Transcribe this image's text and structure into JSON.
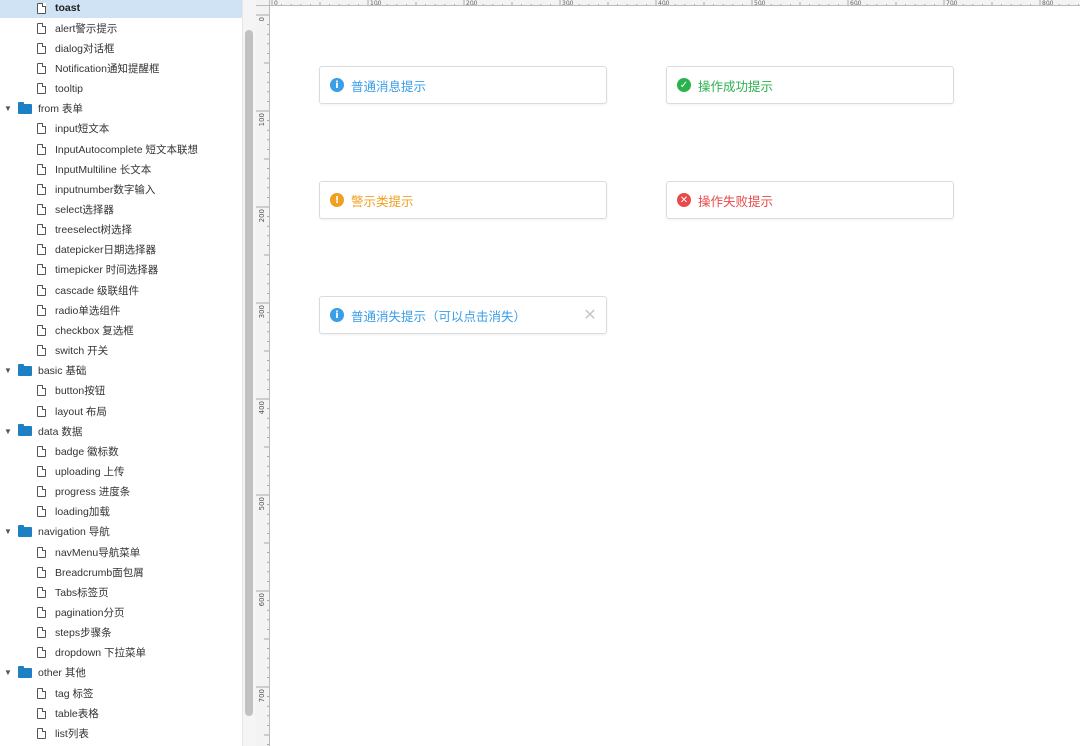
{
  "sidebar": {
    "items": [
      {
        "type": "page",
        "label": "toast",
        "selected": true
      },
      {
        "type": "page",
        "label": "alert警示提示"
      },
      {
        "type": "page",
        "label": "dialog对话框"
      },
      {
        "type": "page",
        "label": "Notification通知提醒框"
      },
      {
        "type": "page",
        "label": "tooltip"
      },
      {
        "type": "folder",
        "label": "from 表单"
      },
      {
        "type": "page",
        "label": "input短文本"
      },
      {
        "type": "page",
        "label": "InputAutocomplete 短文本联想"
      },
      {
        "type": "page",
        "label": "InputMultiline 长文本"
      },
      {
        "type": "page",
        "label": "inputnumber数字输入"
      },
      {
        "type": "page",
        "label": "select选择器"
      },
      {
        "type": "page",
        "label": "treeselect树选择"
      },
      {
        "type": "page",
        "label": "datepicker日期选择器"
      },
      {
        "type": "page",
        "label": "timepicker 时间选择器"
      },
      {
        "type": "page",
        "label": "cascade 级联组件"
      },
      {
        "type": "page",
        "label": "radio单选组件"
      },
      {
        "type": "page",
        "label": "checkbox 复选框"
      },
      {
        "type": "page",
        "label": "switch 开关"
      },
      {
        "type": "folder",
        "label": "basic 基础"
      },
      {
        "type": "page",
        "label": "button按钮"
      },
      {
        "type": "page",
        "label": "layout 布局"
      },
      {
        "type": "folder",
        "label": "data 数据"
      },
      {
        "type": "page",
        "label": "badge 徽标数"
      },
      {
        "type": "page",
        "label": "uploading 上传"
      },
      {
        "type": "page",
        "label": "progress 进度条"
      },
      {
        "type": "page",
        "label": "loading加载"
      },
      {
        "type": "folder",
        "label": "navigation 导航"
      },
      {
        "type": "page",
        "label": "navMenu导航菜单"
      },
      {
        "type": "page",
        "label": "Breadcrumb面包屑"
      },
      {
        "type": "page",
        "label": "Tabs标签页"
      },
      {
        "type": "page",
        "label": "pagination分页"
      },
      {
        "type": "page",
        "label": "steps步骤条"
      },
      {
        "type": "page",
        "label": "dropdown 下拉菜单"
      },
      {
        "type": "folder",
        "label": "other 其他"
      },
      {
        "type": "page",
        "label": "tag 标签"
      },
      {
        "type": "page",
        "label": "table表格"
      },
      {
        "type": "page",
        "label": "list列表"
      }
    ],
    "icons": {
      "page": "file-icon",
      "folder": "folder-icon",
      "caret": "caret-down-icon"
    }
  },
  "rulers": {
    "top_labels": [
      "0",
      "100",
      "200",
      "300",
      "400",
      "500",
      "600",
      "700",
      "800"
    ],
    "left_labels": [
      "0",
      "100",
      "200",
      "300",
      "400",
      "500",
      "600",
      "700"
    ]
  },
  "toasts": [
    {
      "id": "info",
      "text": "普通消息提示",
      "icon": "info-circle-icon",
      "glyph": "i",
      "color": "#3a9ee8",
      "closable": false
    },
    {
      "id": "success",
      "text": "操作成功提示",
      "icon": "check-circle-icon",
      "glyph": "✓",
      "color": "#2ab24d",
      "closable": false
    },
    {
      "id": "warning",
      "text": "警示类提示",
      "icon": "warning-circle-icon",
      "glyph": "!",
      "color": "#f0a020",
      "closable": false
    },
    {
      "id": "error",
      "text": "操作失败提示",
      "icon": "error-circle-icon",
      "glyph": "✕",
      "color": "#e84a4a",
      "closable": false
    },
    {
      "id": "closable",
      "text": "普通消失提示（可以点击消失）",
      "icon": "info-circle-icon",
      "glyph": "i",
      "color": "#3a9ee8",
      "closable": true,
      "close_glyph": "✕",
      "close_icon": "close-icon"
    }
  ],
  "colors": {
    "selection": "#cfe3f5",
    "folder": "#1d7fc4",
    "border": "#dcdcdc"
  }
}
